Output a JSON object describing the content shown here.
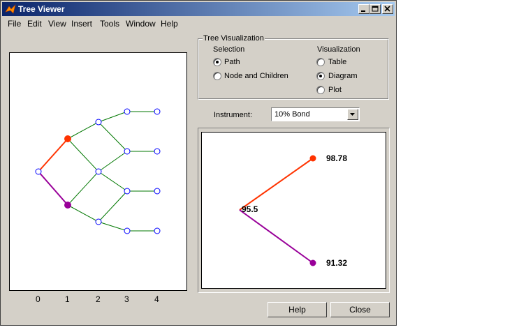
{
  "window": {
    "title": "Tree Viewer"
  },
  "menu": [
    "File",
    "Edit",
    "View",
    "Insert",
    "Tools",
    "Window",
    "Help"
  ],
  "group": {
    "title": "Tree Visualization",
    "selection_label": "Selection",
    "selection_options": [
      "Path",
      "Node and Children"
    ],
    "selection_selected": "Path",
    "visualization_label": "Visualization",
    "visualization_options": [
      "Table",
      "Diagram",
      "Plot"
    ],
    "visualization_selected": "Diagram"
  },
  "instrument": {
    "label": "Instrument:",
    "value": "10% Bond"
  },
  "tree_axis": {
    "ticks": [
      "0",
      "1",
      "2",
      "3",
      "4"
    ]
  },
  "diagram": {
    "root_value": "95.5",
    "up_value": "98.78",
    "down_value": "91.32"
  },
  "buttons": {
    "help": "Help",
    "close": "Close"
  },
  "colors": {
    "path_up": "#ff3300",
    "path_down": "#990099",
    "edge": "#007700",
    "node": "#0000ff"
  }
}
